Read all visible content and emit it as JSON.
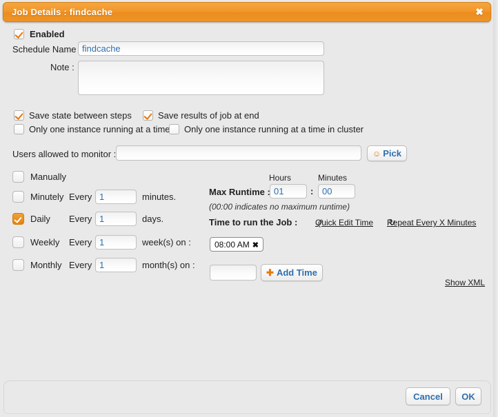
{
  "window": {
    "title": "Job Details : findcache",
    "close_label": "✖"
  },
  "form": {
    "enabled_label": "Enabled",
    "enabled_checked": true,
    "schedule_name_label": "Schedule Name :",
    "schedule_name_value": "findcache",
    "note_label": "Note :",
    "note_value": "",
    "options": [
      {
        "label": "Save state between steps",
        "checked": true
      },
      {
        "label": "Save results of job at end",
        "checked": true
      },
      {
        "label": "Only one instance running at a time",
        "checked": false
      },
      {
        "label": "Only one instance running at a time in cluster",
        "checked": false
      }
    ],
    "users_label": "Users allowed to monitor :",
    "users_value": "",
    "pick_button": "Pick",
    "pick_icon": "user-icon"
  },
  "schedule": {
    "rows": [
      {
        "name": "Manually",
        "selected": false,
        "every": "",
        "value": "",
        "unit": ""
      },
      {
        "name": "Minutely",
        "selected": false,
        "every": "Every",
        "value": "1",
        "unit": "minutes."
      },
      {
        "name": "Daily",
        "selected": true,
        "every": "Every",
        "value": "1",
        "unit": "days."
      },
      {
        "name": "Weekly",
        "selected": false,
        "every": "Every",
        "value": "1",
        "unit": "week(s) on :"
      },
      {
        "name": "Monthly",
        "selected": false,
        "every": "Every",
        "value": "1",
        "unit": "month(s) on :"
      }
    ]
  },
  "runtime": {
    "hours_header": "Hours",
    "minutes_header": "Minutes",
    "max_runtime_label": "Max Runtime :",
    "hours_value": "01",
    "colon": ":",
    "minutes_value": "00",
    "hint": "(00:00 indicates no maximum runtime)",
    "time_to_run_label": "Time to run the Job :",
    "quick_edit_link": "Quick Edit Time",
    "quick_edit_icon": "pencil-icon",
    "repeat_link": "Repeat Every X Minutes",
    "repeat_icon": "refresh-icon",
    "time_tags": [
      {
        "label": "08:00 AM",
        "remove": "✖"
      }
    ],
    "add_time_value": "",
    "add_time_button": "Add Time",
    "add_time_icon": "plus-icon",
    "show_xml_link": "Show XML"
  },
  "footer": {
    "cancel_label": "Cancel",
    "ok_label": "OK"
  },
  "colors": {
    "accent": "#ee9429",
    "link": "#2f6fae",
    "background": "#e9e9e9",
    "check": "#e8790a"
  }
}
